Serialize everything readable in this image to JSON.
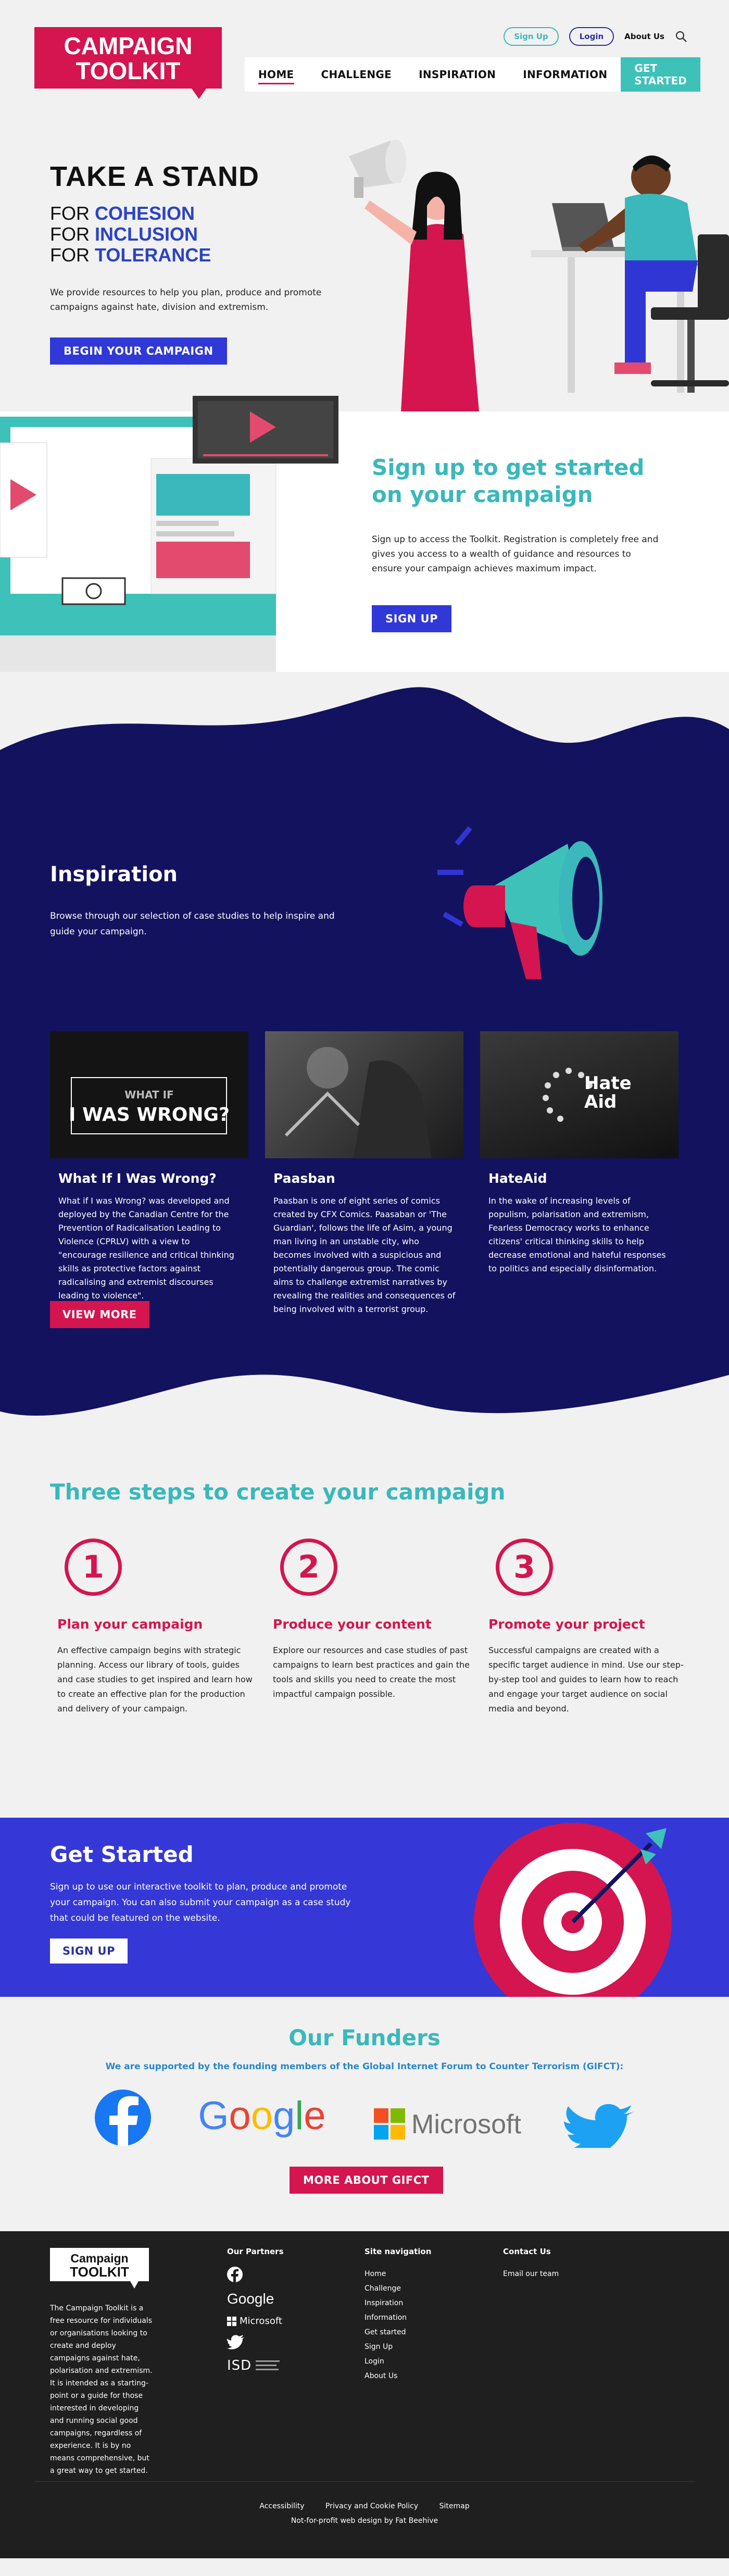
{
  "header": {
    "logo_line1": "CAMPAIGN",
    "logo_line2": "TOOLKIT",
    "signup_pill": "Sign Up",
    "login_pill": "Login",
    "about_link": "About Us",
    "nav": [
      {
        "label": "HOME",
        "active": true
      },
      {
        "label": "CHALLENGE",
        "active": false
      },
      {
        "label": "INSPIRATION",
        "active": false
      },
      {
        "label": "INFORMATION",
        "active": false
      }
    ],
    "get_started": "GET STARTED"
  },
  "hero": {
    "title": "TAKE A STAND",
    "for_prefix": "FOR",
    "for_words": [
      "COHESION",
      "INCLUSION",
      "TOLERANCE"
    ],
    "description": "We provide resources to help you plan, produce and promote campaigns against hate, division and extremism.",
    "cta": "BEGIN YOUR CAMPAIGN"
  },
  "signup": {
    "title": "Sign up to get started on your campaign",
    "description": "Sign up to access the Toolkit. Registration is completely free and gives you access to a wealth of guidance and resources to ensure your campaign achieves maximum impact.",
    "cta": "SIGN UP"
  },
  "inspiration": {
    "title": "Inspiration",
    "description": "Browse through our selection of case studies to help inspire and guide your campaign.",
    "cards": [
      {
        "thumb_small": "WHAT IF",
        "thumb_big": "I WAS WRONG?",
        "title": "What If I Was Wrong?",
        "text": "What if I was Wrong? was developed and deployed by the Canadian Centre for the Prevention of Radicalisation Leading to Violence (CPRLV) with a view to \"encourage resilience and critical thinking skills as protective factors against radicalising and extremist discourses leading to violence\"."
      },
      {
        "thumb_small": "",
        "thumb_big": "",
        "title": "Paasban",
        "text": "Paasban is one of eight series of comics created by CFX Comics. Paasaban or 'The Guardian', follows the life of Asim, a young man living in an unstable city, who becomes involved with a suspicious and potentially dangerous group. The comic aims to challenge extremist narratives by revealing the realities and consequences of being involved with a terrorist group."
      },
      {
        "thumb_small": "Hate",
        "thumb_big": "Aid",
        "title": "HateAid",
        "text": "In the wake of increasing levels of populism, polarisation and extremism, Fearless Democracy works to enhance citizens' critical thinking skills to help decrease emotional and hateful responses to politics and especially disinformation."
      }
    ],
    "view_more": "VIEW MORE"
  },
  "steps": {
    "title": "Three steps to create your campaign",
    "items": [
      {
        "number": "1",
        "title": "Plan your campaign",
        "text": "An effective campaign begins with strategic planning. Access our library of tools, guides and case studies to get inspired and learn how to create an effective plan for the production and delivery of your campaign."
      },
      {
        "number": "2",
        "title": "Produce your content",
        "text": "Explore our resources and case studies of past campaigns to learn best practices and gain the tools and skills you need to create the most impactful campaign possible."
      },
      {
        "number": "3",
        "title": "Promote your project",
        "text": "Successful campaigns are created with a specific target audience in mind. Use our step-by-step tool and guides to learn how to reach and engage your target audience on social media and beyond."
      }
    ]
  },
  "get_started": {
    "title": "Get Started",
    "description": "Sign up to use our interactive toolkit to plan, produce and promote your campaign. You can also submit your campaign as a case study that could be featured on the website.",
    "cta": "SIGN UP"
  },
  "funders": {
    "title": "Our Funders",
    "subtitle": "We are supported by the founding members of the Global Internet Forum to Counter Terrorism (GIFCT):",
    "google": "Google",
    "microsoft": "Microsoft",
    "cta": "MORE ABOUT GIFCT"
  },
  "footer": {
    "logo_line1": "Campaign",
    "logo_line2": "TOOLKIT",
    "about": "The Campaign Toolkit is a free resource for individuals or organisations looking to create and deploy campaigns against hate, polarisation and extremism. It is intended as a starting-point or a guide for those interested in developing and running social good campaigns, regardless of experience. It is by no means comprehensive, but a great way to get started.",
    "partners_heading": "Our Partners",
    "partner_google": "Google",
    "partner_microsoft": "Microsoft",
    "partner_isd": "ISD",
    "nav_heading": "Site navigation",
    "nav_links": [
      "Home",
      "Challenge",
      "Inspiration",
      "Information",
      "Get started",
      "Sign Up",
      "Login",
      "About Us"
    ],
    "contact_heading": "Contact Us",
    "contact_link": "Email our team",
    "bottom_links": [
      "Accessibility",
      "Privacy and Cookie Policy",
      "Sitemap"
    ],
    "credit": "Not-for-profit web design by Fat Beehive"
  },
  "colors": {
    "crimson": "#d4154f",
    "teal": "#3ab8bb",
    "navy": "#13125f",
    "blue": "#3538d6"
  }
}
